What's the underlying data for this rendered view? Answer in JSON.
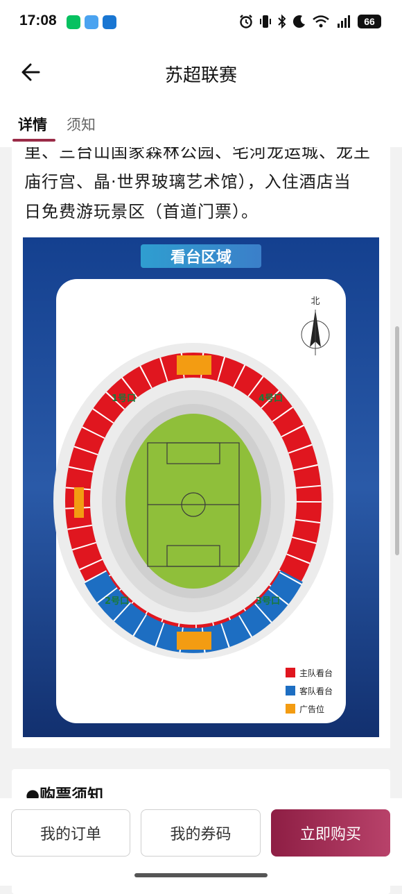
{
  "status_bar": {
    "time": "17:08",
    "battery": "66"
  },
  "nav": {
    "title": "苏超联赛"
  },
  "tabs": [
    {
      "label": "详情",
      "active": true
    },
    {
      "label": "须知",
      "active": false
    }
  ],
  "detail": {
    "text_lines": [
      "里、三台山国家森林公园、宅河龙运城、龙王",
      "庙行宫、晶·世界玻璃艺术馆），入住酒店当",
      "日免费游玩景区（首道门票）。"
    ]
  },
  "stadium_map": {
    "banner": "看台区域",
    "north": "北",
    "gates": [
      "1号口",
      "2号口",
      "3号口",
      "4号口"
    ],
    "legend": [
      {
        "label": "主队看台",
        "color": "#e0161f"
      },
      {
        "label": "客队看台",
        "color": "#1d6ec2"
      },
      {
        "label": "广告位",
        "color": "#f39c12"
      }
    ],
    "colors": {
      "background_top": "#123c8c",
      "background_bottom": "#0f2d6e",
      "pitch": "#8fbf3a",
      "track": "#d9d9d9"
    }
  },
  "notice": {
    "title": "●购票须知"
  },
  "bottom_bar": {
    "my_orders": "我的订单",
    "my_codes": "我的券码",
    "buy_now": "立即购买"
  }
}
